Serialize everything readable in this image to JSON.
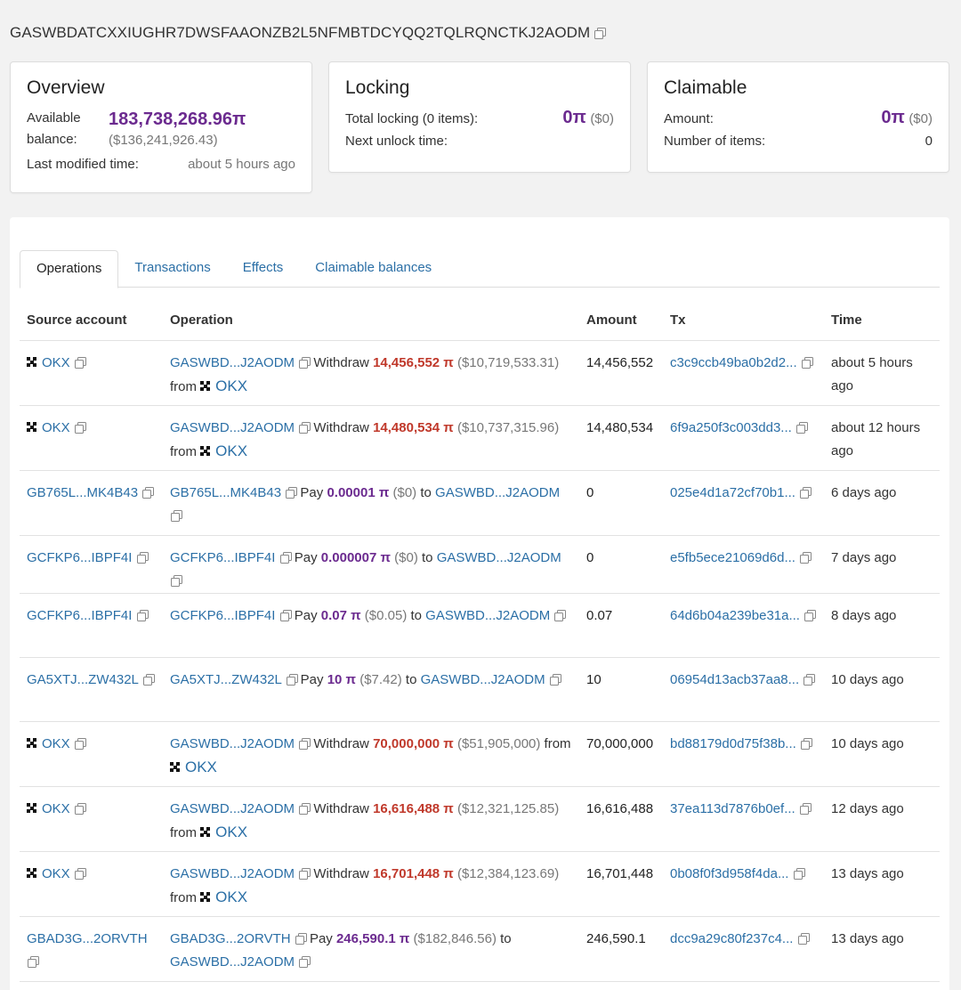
{
  "account": {
    "address": "GASWBDATCXXIUGHR7DWSFAAONZB2L5NFMBTDCYQQ2TQLRQNCTKJ2AODM"
  },
  "overview": {
    "title": "Overview",
    "available_label": "Available balance:",
    "balance": "183,738,268.96π",
    "balance_usd": "($136,241,926.43)",
    "modified_label": "Last modified time:",
    "modified_value": "about 5 hours ago"
  },
  "locking": {
    "title": "Locking",
    "total_label": "Total locking (0 items):",
    "total_value": "0π",
    "total_usd": "($0)",
    "next_label": "Next unlock time:"
  },
  "claimable": {
    "title": "Claimable",
    "amount_label": "Amount:",
    "amount_value": "0π",
    "amount_usd": "($0)",
    "items_label": "Number of items:",
    "items_value": "0"
  },
  "tabs": [
    "Operations",
    "Transactions",
    "Effects",
    "Claimable balances"
  ],
  "table": {
    "headers": [
      "Source account",
      "Operation",
      "Amount",
      "Tx",
      "Time"
    ],
    "rows": [
      {
        "source": "OKX",
        "okx": true,
        "op": {
          "acct": "GASWBD...J2AODM",
          "verb": "Withdraw",
          "amt": "14,456,552 π",
          "usd": "($10,719,533.31)",
          "conn": "from",
          "target": "OKX"
        },
        "amount": "14,456,552",
        "tx": "c3c9ccb49ba0b2d2...",
        "time": "about 5 hours ago"
      },
      {
        "source": "OKX",
        "okx": true,
        "op": {
          "acct": "GASWBD...J2AODM",
          "verb": "Withdraw",
          "amt": "14,480,534 π",
          "usd": "($10,737,315.96)",
          "conn": "from",
          "target": "OKX"
        },
        "amount": "14,480,534",
        "tx": "6f9a250f3c003dd3...",
        "time": "about 12 hours ago"
      },
      {
        "source": "GB765L...MK4B43",
        "okx": false,
        "op": {
          "acct": "GB765L...MK4B43",
          "verb": "Pay",
          "amt": "0.00001 π",
          "usd": "($0)",
          "conn": "to",
          "target": "GASWBD...J2AODM"
        },
        "amount": "0",
        "tx": "025e4d1a72cf70b1...",
        "time": "6 days ago"
      },
      {
        "source": "GCFKP6...IBPF4I",
        "okx": false,
        "op": {
          "acct": "GCFKP6...IBPF4I",
          "verb": "Pay",
          "amt": "0.000007 π",
          "usd": "($0)",
          "conn": "to",
          "target": "GASWBD...J2AODM"
        },
        "amount": "0",
        "tx": "e5fb5ece21069d6d...",
        "time": "7 days ago"
      },
      {
        "source": "GCFKP6...IBPF4I",
        "okx": false,
        "op": {
          "acct": "GCFKP6...IBPF4I",
          "verb": "Pay",
          "amt": "0.07 π",
          "usd": "($0.05)",
          "conn": "to",
          "target": "GASWBD...J2AODM"
        },
        "amount": "0.07",
        "tx": "64d6b04a239be31a...",
        "time": "8 days ago"
      },
      {
        "source": "GA5XTJ...ZW432L",
        "okx": false,
        "op": {
          "acct": "GA5XTJ...ZW432L",
          "verb": "Pay",
          "amt": "10 π",
          "usd": "($7.42)",
          "conn": "to",
          "target": "GASWBD...J2AODM"
        },
        "amount": "10",
        "tx": "06954d13acb37aa8...",
        "time": "10 days ago"
      },
      {
        "source": "OKX",
        "okx": true,
        "op": {
          "acct": "GASWBD...J2AODM",
          "verb": "Withdraw",
          "amt": "70,000,000 π",
          "usd": "($51,905,000)",
          "conn": "from",
          "target": "OKX"
        },
        "amount": "70,000,000",
        "tx": "bd88179d0d75f38b...",
        "time": "10 days ago"
      },
      {
        "source": "OKX",
        "okx": true,
        "op": {
          "acct": "GASWBD...J2AODM",
          "verb": "Withdraw",
          "amt": "16,616,488 π",
          "usd": "($12,321,125.85)",
          "conn": "from",
          "target": "OKX"
        },
        "amount": "16,616,488",
        "tx": "37ea113d7876b0ef...",
        "time": "12 days ago"
      },
      {
        "source": "OKX",
        "okx": true,
        "op": {
          "acct": "GASWBD...J2AODM",
          "verb": "Withdraw",
          "amt": "16,701,448 π",
          "usd": "($12,384,123.69)",
          "conn": "from",
          "target": "OKX"
        },
        "amount": "16,701,448",
        "tx": "0b08f0f3d958f4da...",
        "time": "13 days ago"
      },
      {
        "source": "GBAD3G...2ORVTH",
        "okx": false,
        "op": {
          "acct": "GBAD3G...2ORVTH",
          "verb": "Pay",
          "amt": "246,590.1 π",
          "usd": "($182,846.56)",
          "conn": "to",
          "target": "GASWBD...J2AODM"
        },
        "amount": "246,590.1",
        "tx": "dcc9a29c80f237c4...",
        "time": "13 days ago"
      }
    ]
  }
}
